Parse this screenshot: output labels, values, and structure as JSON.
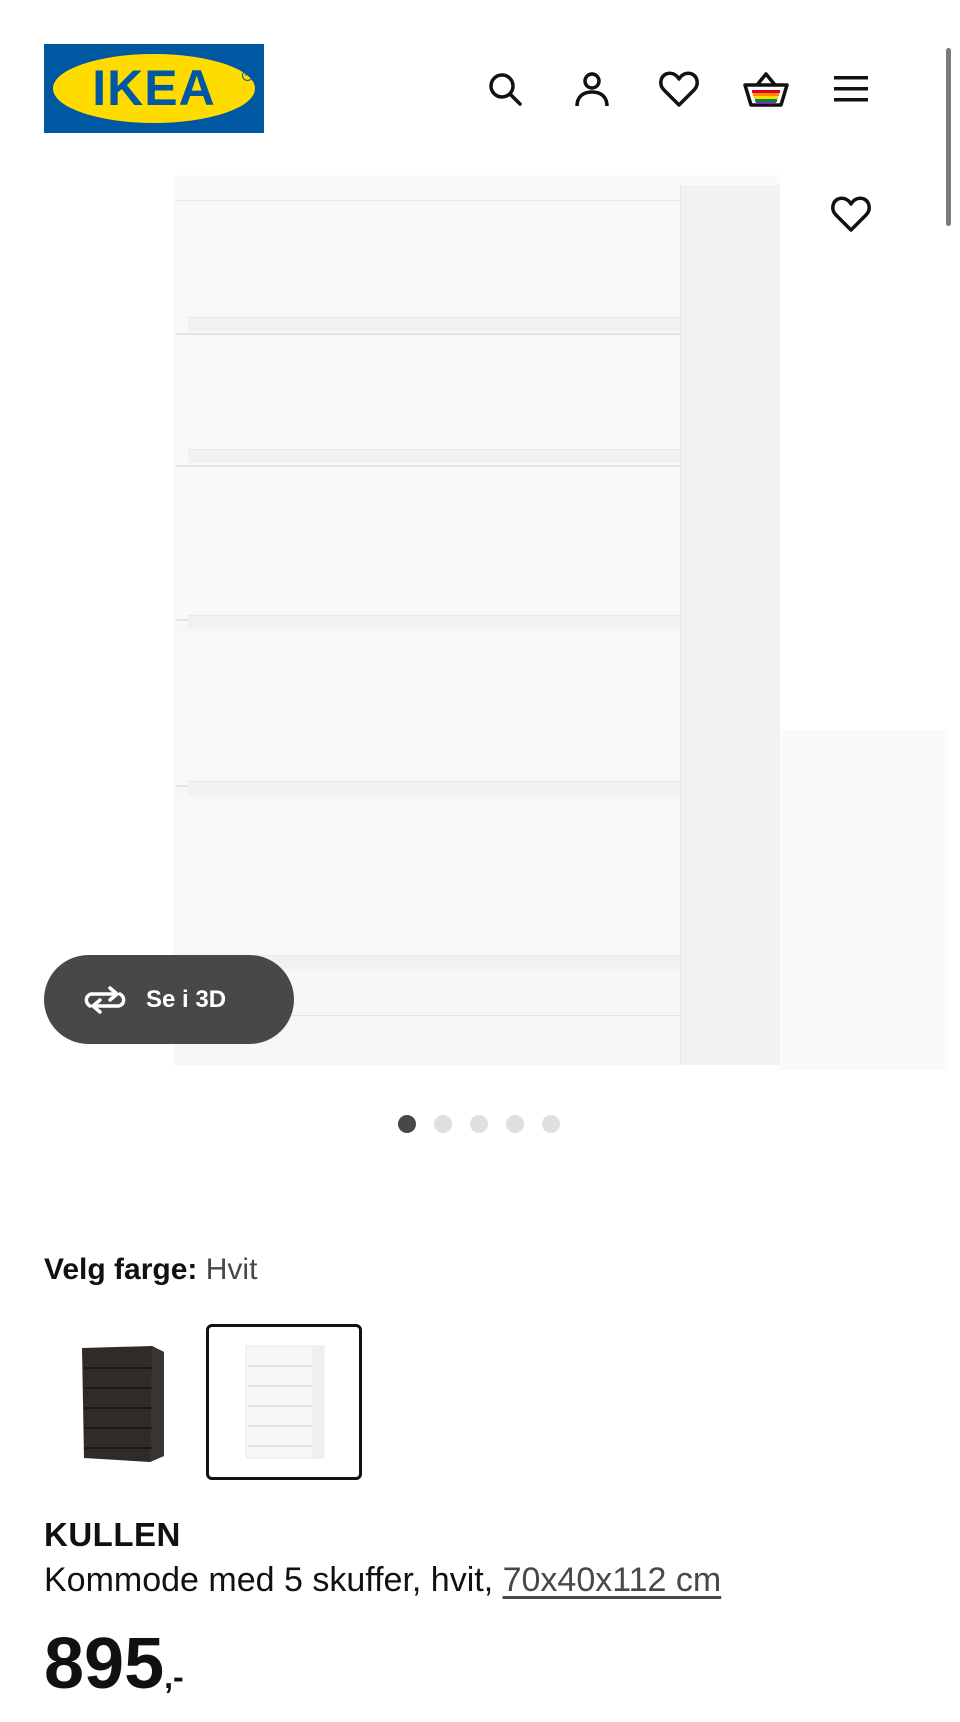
{
  "header": {
    "logo_text": "IKEA",
    "logo_colors": {
      "blue": "#0058a3",
      "yellow": "#ffdb00"
    },
    "icons": [
      "search-icon",
      "account-icon",
      "wishlist-heart-icon",
      "shopping-basket-icon",
      "menu-icon"
    ]
  },
  "gallery": {
    "favorite_icon": "heart-outline-icon",
    "view_3d_label": "Se i 3D",
    "view_3d_icon": "rotate-arrows-icon",
    "image_count": 5,
    "active_image": 1
  },
  "color_selector": {
    "label": "Velg farge:",
    "selected_value": "Hvit",
    "options": [
      {
        "name": "Svartbrun",
        "swatch_color": "#2f2b29",
        "selected": false
      },
      {
        "name": "Hvit",
        "swatch_color": "#f7f7f7",
        "selected": true
      }
    ]
  },
  "product": {
    "brand": "KULLEN",
    "description": "Kommode med 5 skuffer, hvit, ",
    "dimensions": "70x40x112 cm",
    "price": "895",
    "price_suffix": ",-"
  }
}
